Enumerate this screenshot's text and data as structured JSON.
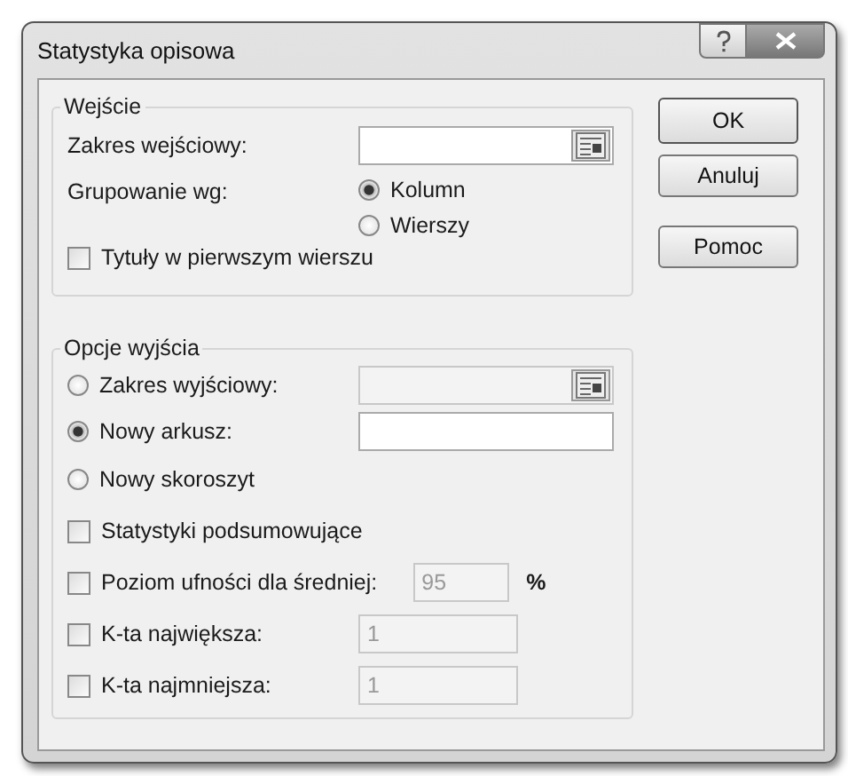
{
  "window": {
    "title": "Statystyka opisowa"
  },
  "input_group": {
    "title": "Wejście",
    "range": {
      "label": "Zakres wejściowy:",
      "field": {
        "disabled": false,
        "picker": true
      }
    },
    "grouping": {
      "label": "Grupowanie wg:",
      "options": [
        {
          "label": "Kolumn",
          "selected": true
        },
        {
          "label": "Wierszy",
          "selected": false
        }
      ]
    },
    "titles": {
      "label": "Tytuły w pierwszym wierszu",
      "checked": false
    }
  },
  "output_group": {
    "title": "Opcje wyjścia",
    "destinations": [
      {
        "label": "Zakres wyjściowy:",
        "selected": false,
        "field": {
          "disabled": true,
          "picker": true
        }
      },
      {
        "label": "Nowy arkusz:",
        "selected": true,
        "field": {
          "disabled": false,
          "picker": false
        }
      },
      {
        "label": "Nowy skoroszyt",
        "selected": false
      }
    ],
    "options": [
      {
        "label": "Statystyki podsumowujące",
        "checked": false
      },
      {
        "label": "Poziom ufności dla średniej:",
        "checked": false,
        "field": {
          "value": "95",
          "disabled": true
        },
        "unit": "%"
      },
      {
        "label": "K-ta największa:",
        "checked": false,
        "field": {
          "value": "1",
          "disabled": true
        }
      },
      {
        "label": "K-ta najmniejsza:",
        "checked": false,
        "field": {
          "value": "1",
          "disabled": true
        }
      }
    ]
  },
  "buttons": [
    {
      "label": "OK"
    },
    {
      "label": "Anuluj"
    },
    {
      "label": "Pomoc"
    }
  ]
}
